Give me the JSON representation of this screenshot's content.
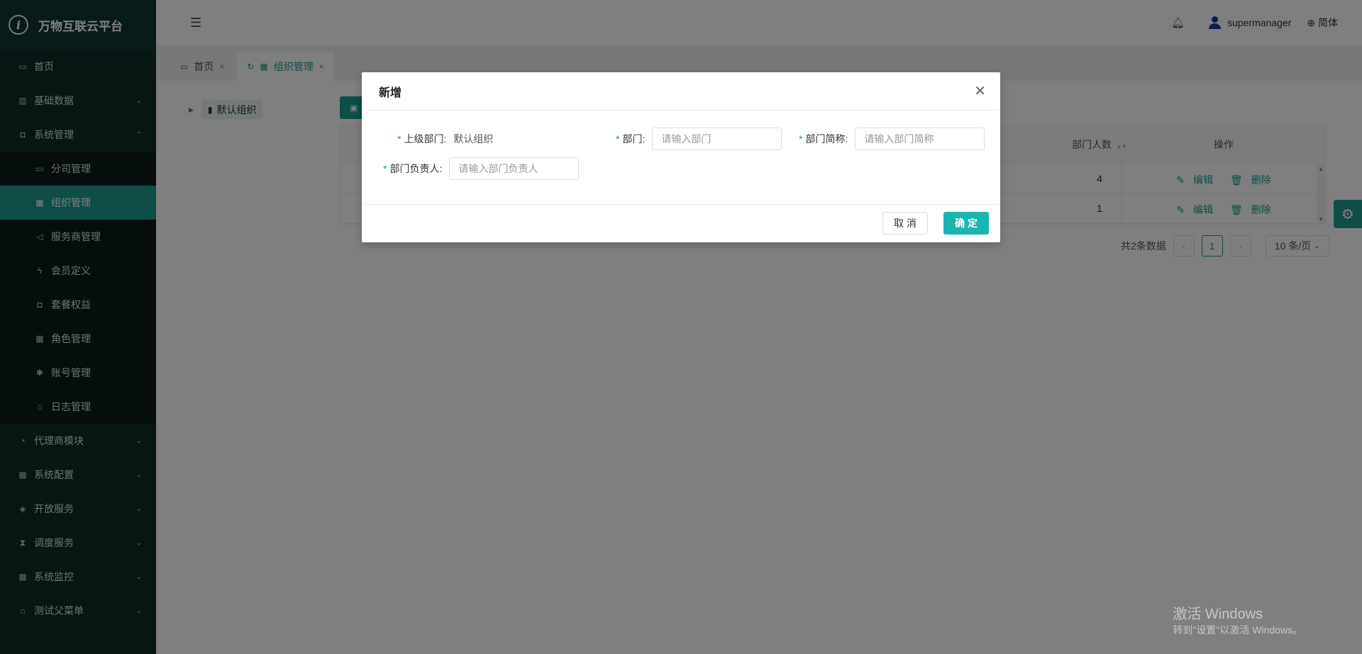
{
  "app": {
    "title": "万物互联云平台"
  },
  "sidebar": {
    "items": [
      {
        "label": "首页",
        "icon": "calendar-icon"
      },
      {
        "label": "基础数据",
        "icon": "barcode-icon",
        "expandable": true
      },
      {
        "label": "系统管理",
        "icon": "camera-icon",
        "expanded": true,
        "children": [
          {
            "label": "分司管理"
          },
          {
            "label": "组织管理",
            "active": true
          },
          {
            "label": "服务商管理"
          },
          {
            "label": "会员定义"
          },
          {
            "label": "套餐权益"
          },
          {
            "label": "角色管理"
          },
          {
            "label": "账号管理"
          },
          {
            "label": "日志管理"
          }
        ]
      },
      {
        "label": "代理商模块",
        "icon": "bell-icon"
      },
      {
        "label": "系统配置",
        "icon": "grid-icon"
      },
      {
        "label": "开放服务",
        "icon": "tag-icon"
      },
      {
        "label": "调度服务",
        "icon": "hourglass-icon"
      },
      {
        "label": "系统监控",
        "icon": "grid-icon"
      },
      {
        "label": "测试父菜单",
        "icon": "bank-icon"
      }
    ]
  },
  "header": {
    "username": "supermanager",
    "language": "简体"
  },
  "tabs": [
    {
      "label": "首页"
    },
    {
      "label": "组织管理",
      "active": true
    }
  ],
  "tree": {
    "root": "默认组织"
  },
  "table": {
    "headers": {
      "people": "部门人数",
      "ops": "操作"
    },
    "rows": [
      {
        "people": "4",
        "edit": "编辑",
        "delete": "删除"
      },
      {
        "people": "1",
        "edit": "编辑",
        "delete": "删除"
      }
    ]
  },
  "pager": {
    "total": "共2条数据",
    "current": "1",
    "size": "10 条/页"
  },
  "modal": {
    "title": "新增",
    "parent_label": "上级部门:",
    "parent_value": "默认组织",
    "dept_label": "部门:",
    "dept_placeholder": "请输入部门",
    "short_label": "部门简称:",
    "short_placeholder": "请输入部门简称",
    "leader_label": "部门负责人:",
    "leader_placeholder": "请输入部门负责人",
    "cancel": "取 消",
    "ok": "确 定"
  },
  "watermark": {
    "line1": "激活 Windows",
    "line2": "转到\"设置\"以激活 Windows。"
  },
  "colors": {
    "accent": "#1e9a8e",
    "sidebar_bg": "#0f2a26",
    "ok_button": "#1ab5b0"
  }
}
